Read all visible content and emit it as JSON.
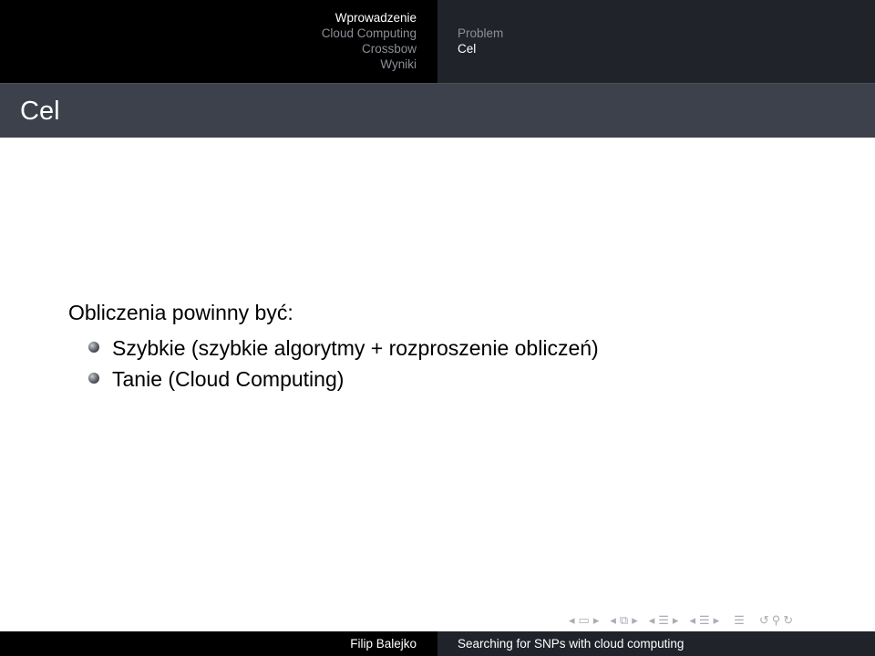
{
  "header": {
    "sections": [
      "Wprowadzenie",
      "Cloud Computing",
      "Crossbow",
      "Wyniki"
    ],
    "active_section": "Wprowadzenie",
    "subsections": [
      "Problem",
      "Cel"
    ],
    "active_subsection": "Cel"
  },
  "frame": {
    "title": "Cel"
  },
  "content": {
    "intro": "Obliczenia powinny być:",
    "bullets": [
      "Szybkie (szybkie algorytmy + rozproszenie obliczeń)",
      "Tanie (Cloud Computing)"
    ]
  },
  "nav_controls": [
    "nav-prev-slide-icon",
    "nav-slide-icon",
    "nav-next-slide-icon",
    "nav-prev-frame-icon",
    "nav-frame-icon",
    "nav-next-frame-icon",
    "nav-prev-subsection-icon",
    "nav-subsection-icon",
    "nav-next-subsection-icon",
    "nav-prev-section-icon",
    "nav-section-icon",
    "nav-next-section-icon",
    "nav-toc-icon",
    "nav-back-icon",
    "nav-search-icon",
    "nav-forward-icon"
  ],
  "footer": {
    "author": "Filip Balejko",
    "title": "Searching for SNPs with cloud computing"
  },
  "colors": {
    "header_left_bg": "#000000",
    "header_right_bg": "#20232a",
    "title_bar_bg": "#3c414b",
    "inactive_text": "#8b8f96",
    "active_text": "#ffffff"
  }
}
